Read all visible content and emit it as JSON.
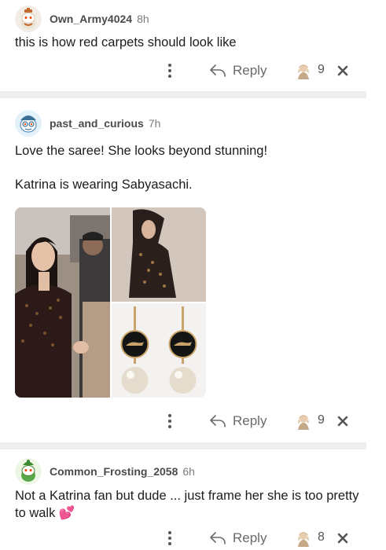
{
  "comments": [
    {
      "username": "Own_Army4024",
      "age": "8h",
      "text": "this is how red carpets should look like",
      "reply_label": "Reply",
      "count": "9"
    },
    {
      "username": "past_and_curious",
      "age": "7h",
      "text_line1": "Love the saree! She looks beyond stunning!",
      "text_line2": "Katrina is wearing Sabyasachi.",
      "reply_label": "Reply",
      "count": "9"
    },
    {
      "username": "Common_Frosting_2058",
      "age": "6h",
      "text": "Not a Katrina fan but dude ... just frame her she is too pretty to walk 💕",
      "reply_label": "Reply",
      "count": "8"
    }
  ],
  "icons": {
    "more": "more-options-icon",
    "reply": "reply-arrow-icon",
    "award": "award-avatar-icon",
    "dismiss": "close-icon"
  },
  "colors": {
    "divider": "#edeff1",
    "username": "#4b4b4b",
    "meta": "#7c7c7c"
  }
}
